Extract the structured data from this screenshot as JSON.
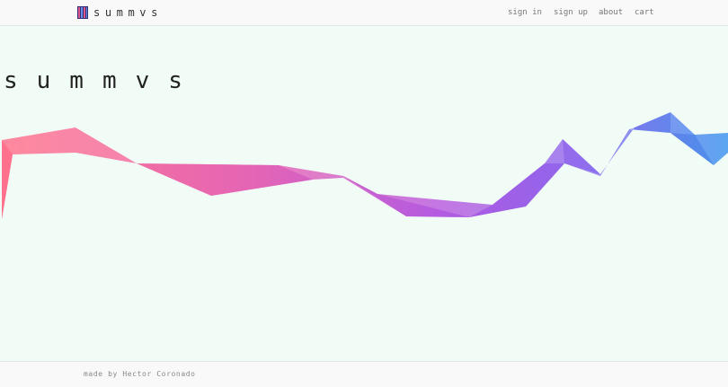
{
  "header": {
    "brand": "summvs",
    "logo_icon": "summvs-logo-icon",
    "nav": {
      "sign_in": "sign in",
      "sign_up": "sign up",
      "about": "about",
      "cart": "cart"
    }
  },
  "hero": {
    "title": "summvs",
    "ribbon_colors": {
      "start": "#ff7a93",
      "middle": "#c26bd8",
      "end": "#3f8fef"
    }
  },
  "footer": {
    "credit": "made by Hector Coronado"
  },
  "colors": {
    "background": "#f2fcf7",
    "bar": "#f9f9f9",
    "text": "#333333"
  }
}
